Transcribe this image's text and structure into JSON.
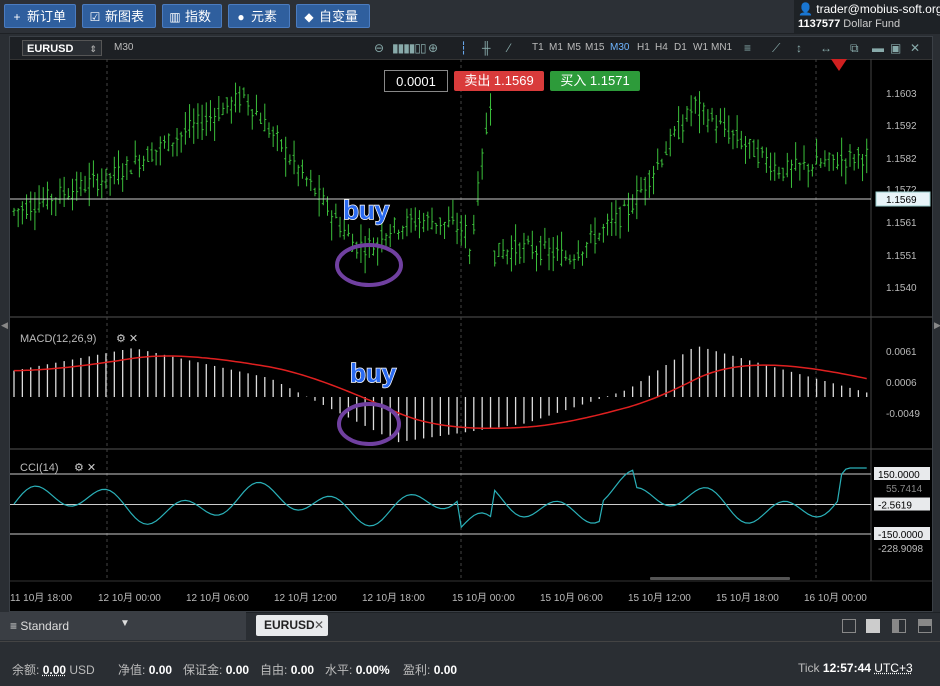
{
  "toolbar": {
    "new_order": "新订单",
    "new_chart": "新图表",
    "indicators": "指数",
    "elements": "元素",
    "variables": "自变量"
  },
  "account": {
    "user": "trader@mobius-soft.org",
    "number": "1137577",
    "fund": "Dollar Fund"
  },
  "chart": {
    "symbol": "EURUSD",
    "timeframe_label": "M30",
    "timeframes": [
      "T1",
      "M1",
      "M5",
      "M15",
      "M30",
      "H1",
      "H4",
      "D1",
      "W1",
      "MN1"
    ],
    "active_timeframe": "M30",
    "step_value": "0.0001",
    "sell_label": "卖出 1.1569",
    "buy_label": "买入 1.1571",
    "price_axis": [
      "1.1603",
      "1.1592",
      "1.1582",
      "1.1572",
      "1.1561",
      "1.1551",
      "1.1540"
    ],
    "current_price": "1.1569",
    "macd_title": "MACD(12,26,9)",
    "macd_axis": [
      "0.0061",
      "0.0006",
      "-0.0049"
    ],
    "cci_title": "CCI(14)",
    "cci_axis": [
      "150.0000",
      "-2.5619",
      "-150.0000",
      "-228.9098"
    ],
    "cci_hidden_label": "55.7414",
    "annotation_buy_1": "buy",
    "annotation_buy_2": "buy",
    "time_axis": [
      "11 10月 18:00",
      "12 10月 00:00",
      "12 10月 06:00",
      "12 10月 12:00",
      "12 10月 18:00",
      "15 10月 00:00",
      "15 10月 06:00",
      "15 10月 12:00",
      "15 10月 18:00",
      "16 10月 00:00"
    ],
    "colors": {
      "candle": "#3bbf3b",
      "macd_signal": "#e02020",
      "cci_line": "#2ab0b8",
      "accent": "#2f5f9e"
    }
  },
  "tabs": {
    "template": "Standard",
    "active_tab": "EURUSD"
  },
  "status": {
    "balance_label": "余额:",
    "balance_value": "0.00",
    "balance_currency": "USD",
    "equity_label": "净值:",
    "equity_value": "0.00",
    "margin_label": "保证金:",
    "margin_value": "0.00",
    "free_label": "自由:",
    "free_value": "0.00",
    "level_label": "水平:",
    "level_value": "0.00%",
    "pl_label": "盈利:",
    "pl_value": "0.00",
    "tick_label": "Tick",
    "time": "12:57:44",
    "timezone": "UTC+3"
  }
}
